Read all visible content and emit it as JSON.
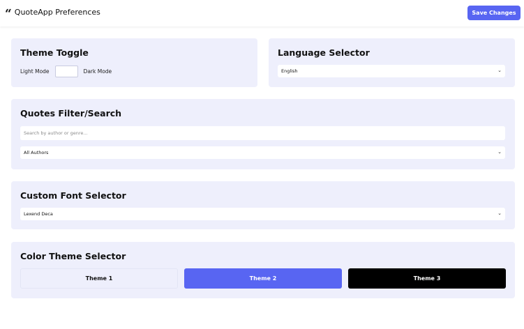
{
  "header": {
    "icon": "quote-icon",
    "icon_glyph": "“",
    "title": "QuoteApp Preferences",
    "save_label": "Save Changes"
  },
  "theme_toggle": {
    "title": "Theme Toggle",
    "light_label": "Light Mode",
    "dark_label": "Dark Mode"
  },
  "language": {
    "title": "Language Selector",
    "selected": "English"
  },
  "quotes_filter": {
    "title": "Quotes Filter/Search",
    "search_placeholder": "Search by author or genre...",
    "author_selected": "All Authors"
  },
  "font_selector": {
    "title": "Custom Font Selector",
    "selected": "Lexend Deca"
  },
  "color_theme": {
    "title": "Color Theme Selector",
    "themes": [
      {
        "label": "Theme 1",
        "bg": "#eeeffc",
        "fg": "#111111"
      },
      {
        "label": "Theme 2",
        "bg": "#5865f2",
        "fg": "#ffffff"
      },
      {
        "label": "Theme 3",
        "bg": "#000000",
        "fg": "#ffffff"
      }
    ]
  },
  "icons": {
    "chevron": "⌄"
  },
  "colors": {
    "accent": "#5865f2",
    "panel_bg": "#eeeffc"
  }
}
